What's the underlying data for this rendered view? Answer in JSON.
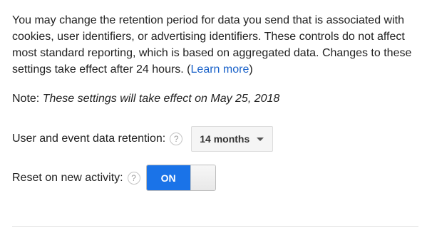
{
  "description": {
    "text": "You may change the retention period for data you send that is associated with cookies, user identifiers, or advertising identifiers. These controls do not affect most standard reporting, which is based on aggregated data. Changes to these settings take effect after 24 hours. (",
    "link": "Learn more",
    "suffix": ")"
  },
  "note": {
    "label": "Note: ",
    "text": "These settings will take effect on May 25, 2018"
  },
  "retention": {
    "label": "User and event data retention:",
    "help_icon": "?",
    "selected": "14 months"
  },
  "reset": {
    "label": "Reset on new activity:",
    "help_icon": "?",
    "toggle_label": "ON",
    "toggle_state": "on"
  },
  "colors": {
    "accent": "#1a73e8",
    "link": "#1a62c9"
  }
}
